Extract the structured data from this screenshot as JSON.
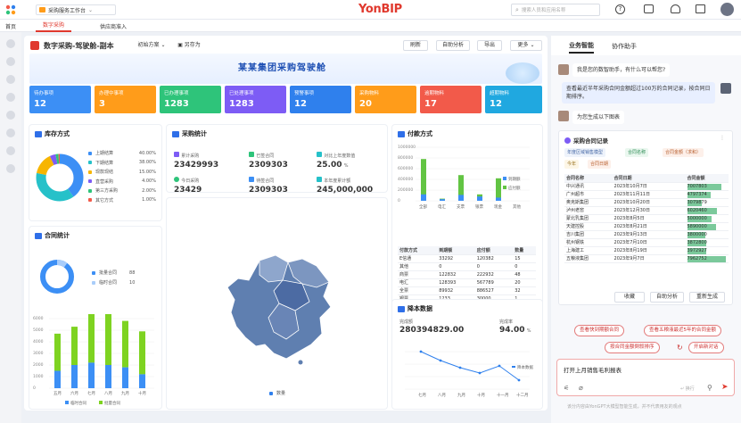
{
  "topbar": {
    "workspace": "采购服务工作台",
    "logo": "YonBIP",
    "search_placeholder": "搜索人员和应用名称"
  },
  "tabs": {
    "home": "首页",
    "active": "数字采购",
    "other": "供应商准入"
  },
  "header": {
    "title": "数字采购-驾驶舱-副本",
    "scheme": "初始方案",
    "save_as": "另存为",
    "buttons": [
      "刷新",
      "自助分析",
      "导出",
      "更多"
    ]
  },
  "banner": {
    "title": "某某集团采购驾驶舱"
  },
  "kpis": [
    {
      "label": "待办事项",
      "value": "12",
      "color": "#3c8ff5"
    },
    {
      "label": "办理中事项",
      "value": "3",
      "color": "#ff9c1a"
    },
    {
      "label": "已办理事项",
      "value": "1283",
      "color": "#2ec47a"
    },
    {
      "label": "已处理事项",
      "value": "1283",
      "color": "#7d5cf5"
    },
    {
      "label": "预警事项",
      "value": "12",
      "color": "#2f80ed"
    },
    {
      "label": "采购物料",
      "value": "20",
      "color": "#ff9c1a"
    },
    {
      "label": "逾期物料",
      "value": "17",
      "color": "#f25a4a"
    },
    {
      "label": "超期物料",
      "value": "12",
      "color": "#20a8e0"
    }
  ],
  "inventory": {
    "title": "库存方式",
    "items": [
      {
        "label": "上期结算",
        "value": "40.00%",
        "color": "#3c8ff5"
      },
      {
        "label": "下期结算",
        "value": "38.00%",
        "color": "#26c1c9"
      },
      {
        "label": "现款现结",
        "value": "15.00%",
        "color": "#f7b500"
      },
      {
        "label": "直营采购",
        "value": "4.00%",
        "color": "#7d5cf5"
      },
      {
        "label": "第三方采购",
        "value": "2.00%",
        "color": "#2ec47a"
      },
      {
        "label": "其它方式",
        "value": "1.00%",
        "color": "#f25a4a"
      }
    ]
  },
  "stats": {
    "title": "采购统计",
    "items": [
      {
        "label": "累计采购",
        "value": "23429993"
      },
      {
        "label": "已签合同",
        "value": "2309303"
      },
      {
        "label": "对比上年度数值",
        "value": "25.00",
        "unit": "%"
      },
      {
        "label": "今日采购",
        "value": "23429"
      },
      {
        "label": "待签合同",
        "value": "2309303"
      },
      {
        "label": "本年度累计额",
        "value": "245,000,000"
      }
    ]
  },
  "payment": {
    "title": "付款方式",
    "ylabels": [
      "1000000",
      "800000",
      "600000",
      "400000",
      "200000",
      "0"
    ],
    "legend": [
      "到期额",
      "应付额"
    ],
    "categories": [
      "全部",
      "电汇",
      "支票",
      "银票",
      "现金",
      "其他"
    ],
    "table_headers": [
      "付款方式",
      "到期额",
      "应付额",
      "数量"
    ],
    "rows": [
      [
        "E信通",
        "33292",
        "120382",
        "15"
      ],
      [
        "其他",
        "0",
        "0",
        "0"
      ],
      [
        "商票",
        "122832",
        "222932",
        "48"
      ],
      [
        "电汇",
        "128393",
        "567789",
        "20"
      ],
      [
        "全票",
        "89932",
        "886527",
        "32"
      ],
      [
        "银票",
        "1233",
        "30000",
        "1"
      ]
    ]
  },
  "contract": {
    "title": "合同统计",
    "legend": [
      {
        "label": "批量合同",
        "value": "88"
      },
      {
        "label": "临时合同",
        "value": "10"
      }
    ],
    "ylabels": [
      "6000",
      "5000",
      "4000",
      "3000",
      "2000",
      "1000",
      "0"
    ],
    "months": [
      "五月",
      "六月",
      "七月",
      "八月",
      "九月",
      "十月"
    ],
    "bar_legend": [
      "临时合同",
      "批量合同"
    ]
  },
  "map": {
    "legend": "数量"
  },
  "reduction": {
    "title": "降本数据",
    "amount_label": "完成额",
    "amount": "280394829.00",
    "rate_label": "完成率",
    "rate": "94.00",
    "rate_unit": "%",
    "months": [
      "七月",
      "八月",
      "九月",
      "十月",
      "十一月",
      "十二月"
    ],
    "legend": "降本数据"
  },
  "assistant": {
    "tab_active": "业务智能",
    "tab_other": "协作助手",
    "greet": "我是您的数智助手，有什么可以帮您?",
    "query": "查看最近半年采购合同金额超过100万的合同记录，按合同日期排序。",
    "reply": "为您生成以下图表",
    "card_title": "采购合同记录",
    "chips": [
      "年度区域销售模型",
      "合同名称",
      "合同金额（求和）",
      "今年",
      "合同日期"
    ],
    "table_headers": [
      "合同名称",
      "合同日期",
      "合同金额"
    ],
    "rows": [
      [
        "中兴通讯",
        "2023年10月7日",
        "7007803"
      ],
      [
        "广州超市",
        "2023年11月11日",
        "4797374"
      ],
      [
        "奥克斯集团",
        "2023年10月20日",
        "3079879"
      ],
      [
        "泸州老窖",
        "2023年12月30日",
        "6020460"
      ],
      [
        "蒙北乳集团",
        "2023年8月5日",
        "5000000"
      ],
      [
        "天建控股",
        "2023年8月21日",
        "5890000"
      ],
      [
        "吉川集团",
        "2023年9月13日",
        "3800000"
      ],
      [
        "杭州钢铁",
        "2023年7月10日",
        "3872800"
      ],
      [
        "上海建工",
        "2023年8月19日",
        "3972927"
      ],
      [
        "五粮液集团",
        "2023年9月7日",
        "7962752"
      ]
    ],
    "actions": [
      "收藏",
      "自助分析",
      "重新生成"
    ],
    "suggestions": [
      "查看快到期额合同",
      "查看五粮液最近5年的合同金额",
      "按合同金额倒叙排序",
      "开启新对话"
    ],
    "input": "打开上月销售毛利报表",
    "send_hint": "↵ 换行",
    "footer": "该分内容由YonGPT大模型智能生成，并不代表用友的观点"
  }
}
